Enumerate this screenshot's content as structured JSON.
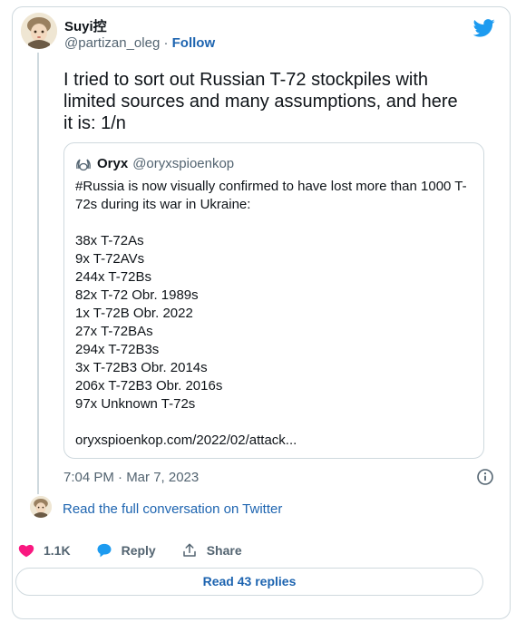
{
  "author": {
    "name": "Suyi控",
    "handle": "@partizan_oleg",
    "separator": "·",
    "follow_label": "Follow"
  },
  "tweet": {
    "text": "I tried to sort out Russian T-72 stockpiles with limited sources and many assumptions, and here it is: 1/n",
    "timestamp": "7:04 PM · Mar 7, 2023"
  },
  "quote": {
    "name": "Oryx",
    "handle": "@oryxspioenkop",
    "intro": "#Russia is now visually confirmed to have lost more than 1000 T-72s during its war in Ukraine:",
    "items": [
      "38x T-72As",
      "9x T-72AVs",
      "244x T-72Bs",
      "82x T-72 Obr. 1989s",
      "1x T-72B Obr. 2022",
      "27x T-72BAs",
      "294x T-72B3s",
      "3x T-72B3 Obr. 2014s",
      "206x T-72B3 Obr. 2016s",
      "97x Unknown T-72s"
    ],
    "link": "oryxspioenkop.com/2022/02/attack..."
  },
  "thread": {
    "read_full_label": "Read the full conversation on Twitter"
  },
  "actions": {
    "likes": "1.1K",
    "reply_label": "Reply",
    "share_label": "Share",
    "read_replies_label": "Read 43 replies"
  },
  "colors": {
    "link": "#1d64b0",
    "like": "#f91880",
    "reply_icon": "#1d9bf0",
    "twitter_logo": "#1d9bf0",
    "border": "#cfd9de",
    "secondary_text": "#536471"
  },
  "icons": {
    "brand": "twitter-bird-icon",
    "info": "info-icon",
    "like": "heart-icon",
    "reply": "speech-bubble-icon",
    "share": "share-upload-icon",
    "quote_avatar": "oryx-logo-icon"
  }
}
